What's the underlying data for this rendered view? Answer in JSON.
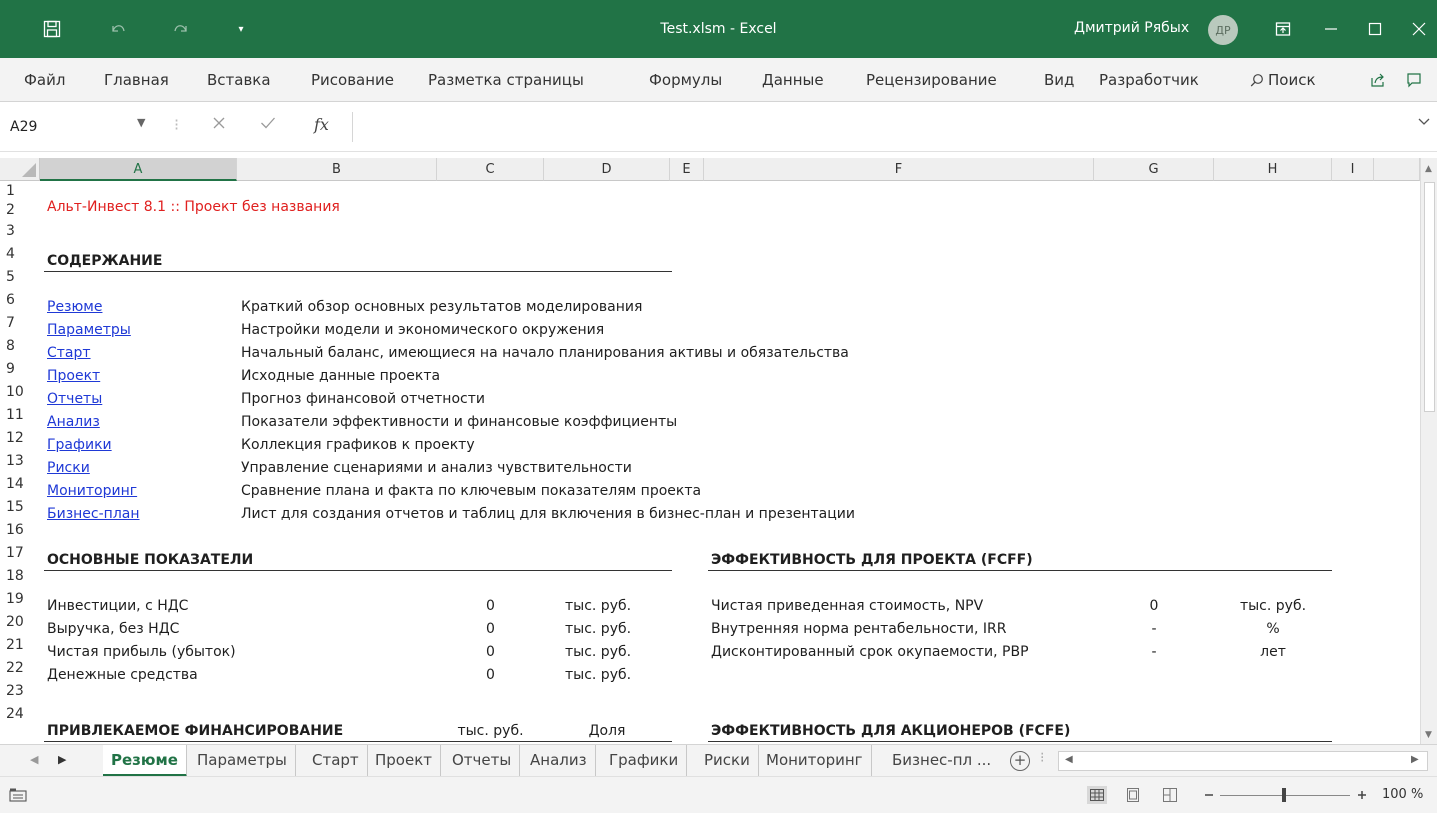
{
  "window": {
    "title": "Test.xlsm  -  Excel",
    "user_name": "Дмитрий Рябых",
    "user_initials": "ДР"
  },
  "ribbon": {
    "tabs": [
      "Файл",
      "Главная",
      "Вставка",
      "Рисование",
      "Разметка страницы",
      "Формулы",
      "Данные",
      "Рецензирование",
      "Вид",
      "Разработчик"
    ],
    "search_label": "Поиск"
  },
  "formula_bar": {
    "name_box": "A29",
    "fx_label": "fx",
    "value": ""
  },
  "columns": [
    "A",
    "B",
    "C",
    "D",
    "E",
    "F",
    "G",
    "H",
    "I"
  ],
  "rows": [
    "1",
    "2",
    "3",
    "4",
    "5",
    "6",
    "7",
    "8",
    "9",
    "10",
    "11",
    "12",
    "13",
    "14",
    "15",
    "16",
    "17",
    "18",
    "19",
    "20",
    "21",
    "22",
    "23",
    "24"
  ],
  "sheet": {
    "title": "Альт-Инвест 8.1 :: Проект без названия",
    "contents_header": "СОДЕРЖАНИЕ",
    "contents": [
      {
        "link": "Резюме",
        "desc": "Краткий обзор основных результатов моделирования"
      },
      {
        "link": "Параметры",
        "desc": "Настройки модели и экономического окружения"
      },
      {
        "link": "Старт",
        "desc": "Начальный баланс, имеющиеся на начало планирования активы и обязательства"
      },
      {
        "link": "Проект",
        "desc": "Исходные данные проекта"
      },
      {
        "link": "Отчеты",
        "desc": "Прогноз финансовой отчетности"
      },
      {
        "link": "Анализ",
        "desc": "Показатели эффективности и финансовые коэффициенты"
      },
      {
        "link": "Графики",
        "desc": "Коллекция графиков к проекту"
      },
      {
        "link": "Риски",
        "desc": "Управление сценариями и анализ чувствительности"
      },
      {
        "link": "Мониторинг",
        "desc": "Сравнение плана и факта по ключевым показателям проекта"
      },
      {
        "link": "Бизнес-план",
        "desc": "Лист для создания отчетов и таблиц для включения в бизнес-план и презентации"
      }
    ],
    "main_header": "ОСНОВНЫЕ ПОКАЗАТЕЛИ",
    "main": [
      {
        "label": "Инвестиции, с НДС",
        "value": "0",
        "unit": "тыс. руб."
      },
      {
        "label": "Выручка, без НДС",
        "value": "0",
        "unit": "тыс. руб."
      },
      {
        "label": "Чистая прибыль (убыток)",
        "value": "0",
        "unit": "тыс. руб."
      },
      {
        "label": "Денежные средства",
        "value": "0",
        "unit": "тыс. руб."
      }
    ],
    "fcff_header": "ЭФФЕКТИВНОСТЬ ДЛЯ ПРОЕКТА (FCFF)",
    "fcff": [
      {
        "label": "Чистая приведенная стоимость, NPV",
        "value": "0",
        "unit": "тыс. руб."
      },
      {
        "label": "Внутренняя норма рентабельности, IRR",
        "value": "-",
        "unit": "%"
      },
      {
        "label": "Дисконтированный срок окупаемости, PBP",
        "value": "-",
        "unit": "лет"
      }
    ],
    "financing_header": "ПРИВЛЕКАЕМОЕ ФИНАНСИРОВАНИЕ",
    "financing_col1": "тыс. руб.",
    "financing_col2": "Доля",
    "fcfe_header": "ЭФФЕКТИВНОСТЬ ДЛЯ АКЦИОНЕРОВ (FCFE)"
  },
  "sheet_tabs": [
    "Резюме",
    "Параметры",
    "Старт",
    "Проект",
    "Отчеты",
    "Анализ",
    "Графики",
    "Риски",
    "Мониторинг",
    "Бизнес-пл ..."
  ],
  "active_sheet": "Резюме",
  "status": {
    "zoom": "100 %"
  },
  "colors": {
    "accent": "#217346",
    "title_red": "#e0201f",
    "link_blue": "#1f39d6"
  }
}
